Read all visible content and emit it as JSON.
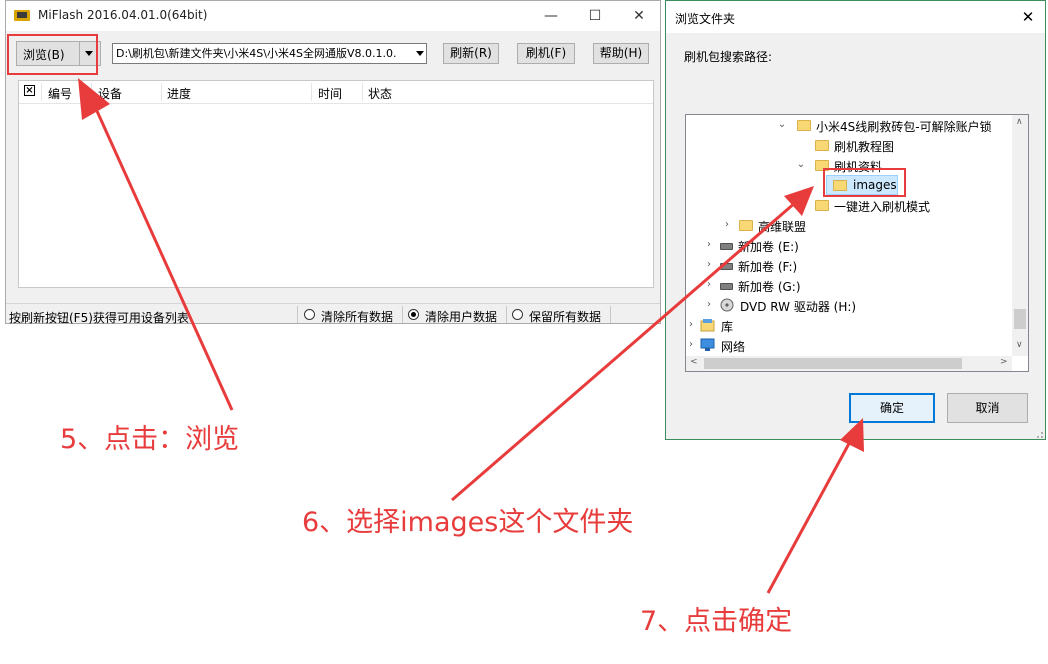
{
  "miflash": {
    "title": "MiFlash 2016.04.01.0(64bit)",
    "window_controls": {
      "minimize": "—",
      "maximize": "☐",
      "close": "✕"
    },
    "browse_label": "浏览(B)",
    "path_value": "D:\\刷机包\\新建文件夹\\小米4S\\小米4S全网通版V8.0.1.0.",
    "buttons": {
      "refresh": "刷新(R)",
      "flash": "刷机(F)",
      "help": "帮助(H)"
    },
    "columns": {
      "number": "编号",
      "device": "设备",
      "progress": "进度",
      "time": "时间",
      "status": "状态"
    },
    "status_text": "按刷新按钮(F5)获得可用设备列表",
    "radio_options": [
      {
        "label": "清除所有数据",
        "selected": false
      },
      {
        "label": "清除用户数据",
        "selected": true
      },
      {
        "label": "保留所有数据",
        "selected": false
      }
    ]
  },
  "dialog": {
    "title": "浏览文件夹",
    "close_glyph": "✕",
    "prompt": "刷机包搜索路径:",
    "tree": [
      {
        "label": "小米4S线刷救砖包-可解除账户锁",
        "icon": "folder-icon",
        "expander": "expanded"
      },
      {
        "label": "刷机教程图",
        "icon": "folder-icon",
        "expander": "none"
      },
      {
        "label": "刷机资料",
        "icon": "folder-icon",
        "expander": "expanded"
      },
      {
        "label": "images",
        "icon": "folder-icon",
        "expander": "none",
        "selected": true
      },
      {
        "label": "一键进入刷机模式",
        "icon": "folder-icon",
        "expander": "none"
      },
      {
        "label": "高维联盟",
        "icon": "folder-icon",
        "expander": "collapsed"
      },
      {
        "label": "新加卷 (E:)",
        "icon": "drive-icon",
        "expander": "collapsed"
      },
      {
        "label": "新加卷 (F:)",
        "icon": "drive-icon",
        "expander": "collapsed"
      },
      {
        "label": "新加卷 (G:)",
        "icon": "drive-icon",
        "expander": "collapsed"
      },
      {
        "label": "DVD RW 驱动器 (H:)",
        "icon": "dvd-drive-icon",
        "expander": "collapsed"
      },
      {
        "label": "库",
        "icon": "library-icon",
        "expander": "collapsed"
      },
      {
        "label": "网络",
        "icon": "network-icon",
        "expander": "collapsed"
      }
    ],
    "ok": "确定",
    "cancel": "取消"
  },
  "annotations": {
    "step5": "5、点击：浏览",
    "step6": "6、选择images这个文件夹",
    "step7": "7、点击确定",
    "color": "#e83c3c"
  }
}
